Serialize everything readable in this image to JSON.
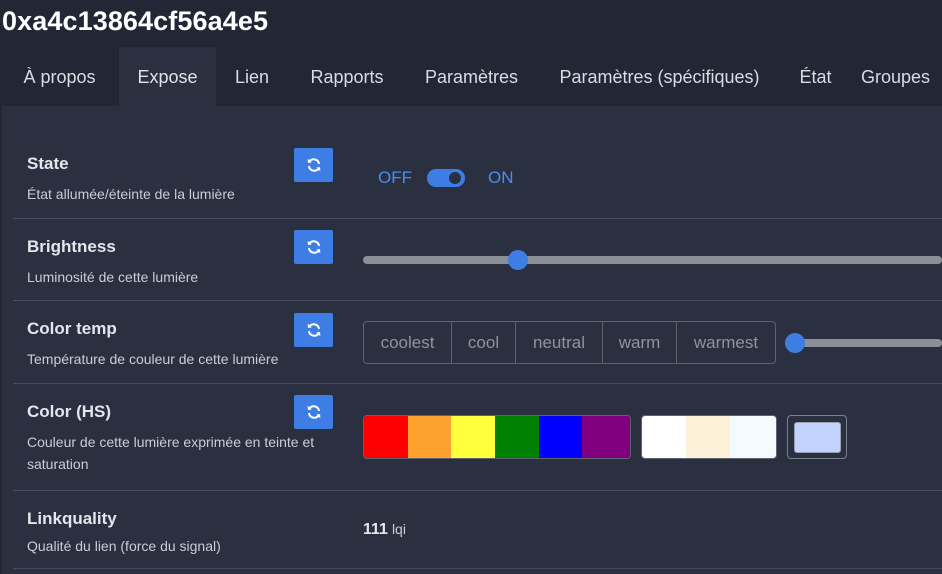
{
  "device": {
    "title": "0xa4c13864cf56a4e5"
  },
  "tabs": [
    {
      "label": "À propos"
    },
    {
      "label": "Expose"
    },
    {
      "label": "Lien"
    },
    {
      "label": "Rapports"
    },
    {
      "label": "Paramètres"
    },
    {
      "label": "Paramètres (spécifiques)"
    },
    {
      "label": "État"
    },
    {
      "label": "Groupes"
    }
  ],
  "active_tab": "Expose",
  "features": {
    "state": {
      "title": "State",
      "description": "État allumée/éteinte de la lumière",
      "off_label": "OFF",
      "on_label": "ON",
      "value": "ON"
    },
    "brightness": {
      "title": "Brightness",
      "description": "Luminosité de cette lumière",
      "value_fraction": 0.26
    },
    "color_temp": {
      "title": "Color temp",
      "description": "Température de couleur de cette lumière",
      "presets": [
        "coolest",
        "cool",
        "neutral",
        "warm",
        "warmest"
      ],
      "value_fraction": 0.0
    },
    "color_hs": {
      "title": "Color (HS)",
      "description": "Couleur de cette lumière exprimée en teinte et saturation",
      "swatches": [
        "#ff0000",
        "#ffa12e",
        "#ffff3c",
        "#008000",
        "#0000ff",
        "#800080"
      ],
      "white_swatches": [
        "#ffffff",
        "#fdf1da",
        "#f3fbff"
      ],
      "current_color": "#c3d3ff"
    },
    "linkquality": {
      "title": "Linkquality",
      "description": "Qualité du lien (force du signal)",
      "value": "111",
      "unit": "lqi"
    }
  },
  "colors": {
    "accent": "#3d7de4",
    "background": "#222735",
    "panel": "#2b3040"
  }
}
